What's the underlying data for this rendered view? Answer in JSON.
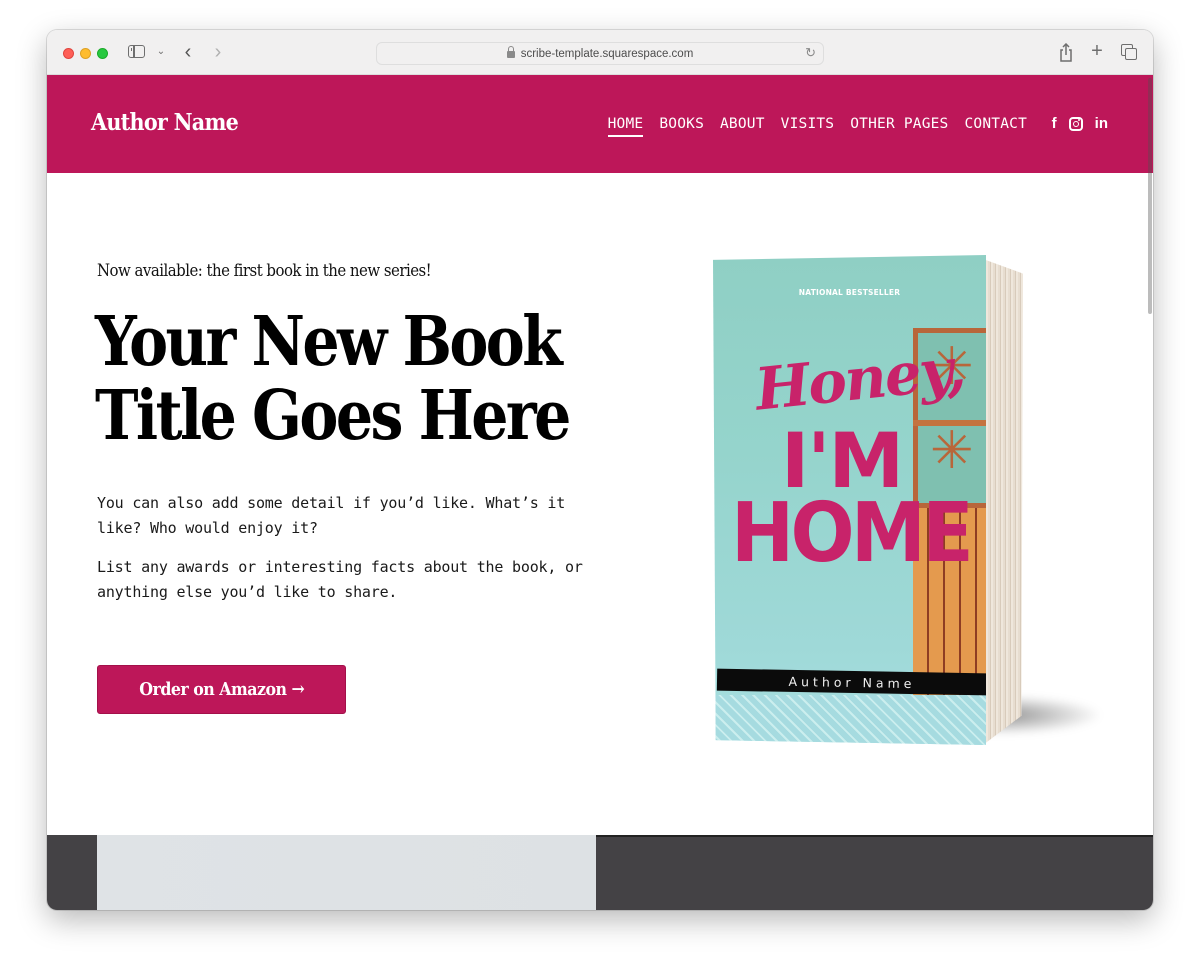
{
  "browser": {
    "url": "scribe-template.squarespace.com",
    "icons": {
      "sidebar": "sidebar-toggle-icon",
      "tab_overview_chevron": "chevron-down-icon",
      "back": "chevron-left-icon",
      "forward": "chevron-right-icon",
      "lock": "lock-icon",
      "reload": "reload-icon",
      "share": "share-icon",
      "new_tab": "plus-icon",
      "tabs": "tabs-icon"
    },
    "glyphs": {
      "chevron_down": "⌄",
      "back": "‹",
      "forward": "›",
      "reload": "↻",
      "share": "⇧",
      "plus": "+"
    }
  },
  "site": {
    "brand_color": "#bd1759",
    "title": "Author Name",
    "nav": [
      {
        "label": "HOME",
        "active": true
      },
      {
        "label": "BOOKS",
        "active": false
      },
      {
        "label": "ABOUT",
        "active": false
      },
      {
        "label": "VISITS",
        "active": false
      },
      {
        "label": "OTHER PAGES",
        "active": false
      },
      {
        "label": "CONTACT",
        "active": false
      }
    ],
    "social": {
      "facebook": "f",
      "linkedin": "in"
    }
  },
  "hero": {
    "eyebrow": "Now available: the first book in the new series!",
    "headline_line1": "Your New Book",
    "headline_line2": "Title Goes Here",
    "paragraph1": "You can also add some detail if you’d like. What’s it like? Who would enjoy it?",
    "paragraph2": "List any awards or interesting facts about the book, or anything else you’d like to share.",
    "cta_label": "Order on Amazon →"
  },
  "book_cover": {
    "eyebrow": "NATIONAL BESTSELLER",
    "script_title": "Honey,",
    "big_title_line1": "I'M",
    "big_title_line2": "HOME",
    "author": "Author Name",
    "accent_color": "#c8236a"
  }
}
